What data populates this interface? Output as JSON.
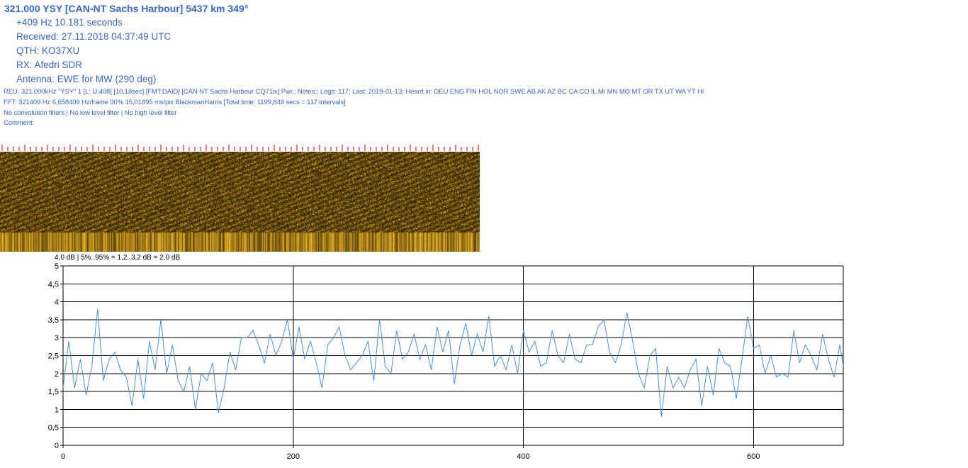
{
  "header": {
    "title": "321.000 YSY [CAN-NT Sachs Harbour] 5437 km 349°",
    "offset": "+409 Hz 10.181 seconds",
    "received": "Received: 27.11.2018 04:37:49 UTC",
    "qth": "QTH: KO37XU",
    "rx": "RX: Afedri SDR",
    "antenna": "Antenna: EWE for MW (290 deg)"
  },
  "details": {
    "reu": "REU: 321.000kHz \"YSY\" 1 [L: U:408] [10,18sec] [FMT:DAID] [CAN NT Sachs Harbour CQ71ix] Pwr.; Notes:; Logs: 117; Last: 2019-01-13; Heard in: DEU ENG FIN HOL NOR SWE AB AK AZ BC CA CO IL MI MN MO MT OR TX UT WA YT HI",
    "fft": "FFT: 321409 Hz 6,658409 Hz/frame 90% 15,01895 ms/pix BlackmanHarris [Total time: 1199,849 secs = 117 intervals]",
    "filters": "No convolution filters | No low level filter | No high level filter",
    "comment": "Comment:"
  },
  "stats": "4,0 dB | 5%..95% = 1,2..3,2 dB = 2,0 dB",
  "colors": {
    "line": "#4a90d9",
    "spectro_dark": "#1a1200",
    "spectro_bright": "#f0c020",
    "tick_red": "#c00000"
  },
  "chart_data": {
    "type": "line",
    "xlim": [
      0,
      678
    ],
    "ylim": [
      0,
      5
    ],
    "x_ticks": [
      "0",
      "200",
      "400",
      "600"
    ],
    "y_ticks": [
      "0",
      "0,5",
      "1",
      "1,5",
      "2",
      "2,5",
      "3",
      "3,5",
      "4",
      "4,5",
      "5"
    ],
    "grid": true,
    "series": [
      {
        "x": [
          0,
          5,
          10,
          15,
          20,
          25,
          30,
          35,
          40,
          45,
          50,
          55,
          60,
          65,
          70,
          75,
          80,
          85,
          90,
          95,
          100,
          105,
          110,
          115,
          120,
          125,
          130,
          135,
          140,
          145,
          150,
          155,
          160,
          165,
          170,
          175,
          180,
          185,
          190,
          195,
          200,
          205,
          210,
          215,
          220,
          225,
          230,
          235,
          240,
          245,
          250,
          255,
          260,
          265,
          270,
          275,
          280,
          285,
          290,
          295,
          300,
          305,
          310,
          315,
          320,
          325,
          330,
          335,
          340,
          345,
          350,
          355,
          360,
          365,
          370,
          375,
          380,
          385,
          390,
          395,
          400,
          405,
          410,
          415,
          420,
          425,
          430,
          435,
          440,
          445,
          450,
          455,
          460,
          465,
          470,
          475,
          480,
          485,
          490,
          495,
          500,
          505,
          510,
          515,
          520,
          525,
          530,
          535,
          540,
          545,
          550,
          555,
          560,
          565,
          570,
          575,
          580,
          585,
          590,
          595,
          600,
          605,
          610,
          615,
          620,
          625,
          630,
          635,
          640,
          645,
          650,
          655,
          660,
          665,
          670,
          675,
          678
        ],
        "values": [
          1.6,
          2.9,
          1.6,
          2.4,
          1.4,
          2.2,
          3.8,
          1.8,
          2.4,
          2.6,
          2.1,
          1.9,
          1.1,
          2.4,
          1.3,
          2.9,
          2.1,
          3.5,
          2.0,
          2.8,
          1.8,
          1.5,
          2.2,
          1.0,
          2.0,
          1.8,
          2.3,
          0.9,
          1.6,
          2.6,
          2.1,
          3.0,
          3.0,
          3.2,
          2.8,
          2.3,
          3.1,
          2.5,
          2.9,
          3.5,
          2.4,
          3.3,
          2.4,
          2.9,
          2.3,
          1.6,
          2.8,
          3.0,
          3.3,
          2.5,
          2.1,
          2.3,
          2.5,
          2.9,
          1.8,
          3.5,
          2.2,
          2.0,
          3.2,
          2.4,
          2.6,
          3.1,
          2.4,
          2.8,
          2.1,
          3.3,
          2.6,
          3.2,
          1.7,
          2.8,
          3.4,
          2.5,
          3.1,
          2.6,
          3.6,
          2.2,
          2.5,
          2.1,
          2.8,
          2.0,
          3.2,
          2.6,
          2.9,
          2.2,
          2.3,
          3.2,
          2.5,
          2.3,
          3.1,
          2.4,
          2.3,
          2.8,
          2.8,
          3.3,
          3.5,
          2.6,
          2.3,
          2.8,
          3.7,
          2.9,
          2.0,
          1.6,
          2.5,
          2.7,
          0.8,
          2.2,
          1.6,
          1.9,
          1.6,
          2.1,
          2.4,
          1.1,
          2.2,
          1.4,
          2.7,
          2.3,
          2.2,
          1.3,
          2.4,
          3.6,
          2.7,
          2.8,
          2.0,
          2.5,
          1.9,
          2.0,
          1.9,
          3.2,
          2.3,
          2.8,
          2.5,
          2.1,
          3.1,
          2.4,
          1.9,
          2.8,
          2.2
        ]
      }
    ]
  }
}
